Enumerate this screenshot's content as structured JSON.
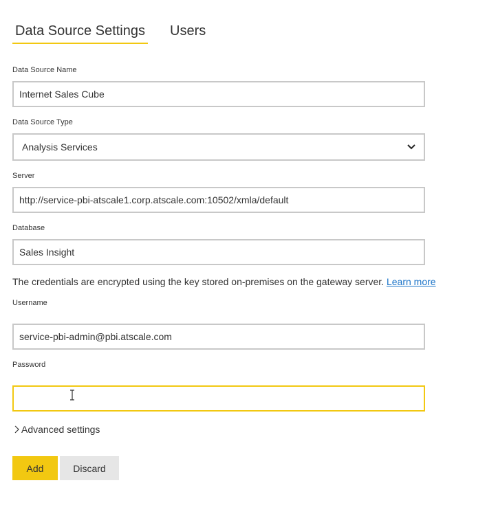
{
  "tabs": {
    "active": "Data Source Settings",
    "users": "Users"
  },
  "form": {
    "data_source_name": {
      "label": "Data Source Name",
      "value": "Internet Sales Cube"
    },
    "data_source_type": {
      "label": "Data Source Type",
      "value": "Analysis Services"
    },
    "server": {
      "label": "Server",
      "value": "http://service-pbi-atscale1.corp.atscale.com:10502/xmla/default"
    },
    "database": {
      "label": "Database",
      "value": "Sales Insight"
    },
    "credentials_note": "The credentials are encrypted using the key stored on-premises on the gateway server.",
    "learn_more": "Learn more",
    "username": {
      "label": "Username",
      "value": "service-pbi-admin@pbi.atscale.com"
    },
    "password": {
      "label": "Password",
      "value": ""
    },
    "advanced_settings": "Advanced settings"
  },
  "buttons": {
    "add": "Add",
    "discard": "Discard"
  },
  "colors": {
    "accent": "#f2c811",
    "link": "#1a73c8",
    "border": "#c8c8c8",
    "secondary_button": "#e6e6e6"
  },
  "icons": {
    "select": "chevron-down-icon",
    "advanced": "chevron-right-icon",
    "cursor": "text-cursor-icon"
  }
}
